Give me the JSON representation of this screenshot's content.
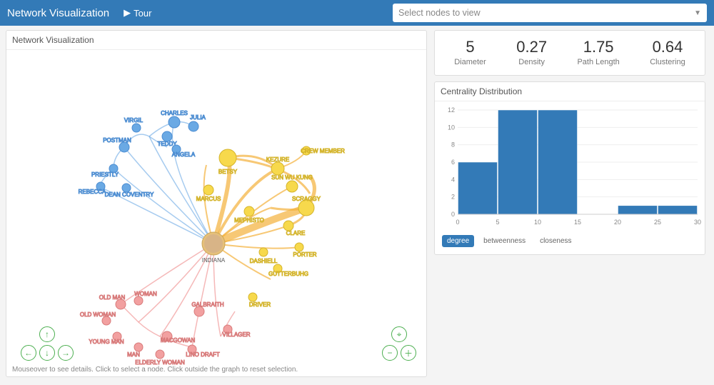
{
  "topbar": {
    "title": "Network Visualization",
    "tour": "Tour",
    "select_placeholder": "Select nodes to view"
  },
  "graph_panel": {
    "title": "Network Visualization",
    "hint": "Mouseover to see details. Click to select a node. Click outside the graph to reset selection."
  },
  "stats": [
    {
      "value": "5",
      "label": "Diameter"
    },
    {
      "value": "0.27",
      "label": "Density"
    },
    {
      "value": "1.75",
      "label": "Path Length"
    },
    {
      "value": "0.64",
      "label": "Clustering"
    }
  ],
  "centrality_panel_title": "Centrality Distribution",
  "centrality_buttons": {
    "degree": "degree",
    "betweenness": "betweenness",
    "closeness": "closeness"
  },
  "chart_data": {
    "type": "bar",
    "categories": [
      0,
      5,
      10,
      15,
      20,
      25,
      30
    ],
    "bin_edges": [
      0,
      5,
      10,
      15,
      20,
      25,
      30
    ],
    "values": [
      6,
      12,
      12,
      0,
      1,
      1
    ],
    "ylabel": "",
    "xlabel": "",
    "ylim": [
      0,
      12
    ],
    "y_ticks": [
      0,
      2,
      4,
      6,
      8,
      10,
      12
    ],
    "bar_color": "#337ab7"
  },
  "graph_nodes": {
    "center": {
      "label": "INDIANA"
    },
    "blue": [
      {
        "label": "CHARLES"
      },
      {
        "label": "JULIA"
      },
      {
        "label": "TEDDY"
      },
      {
        "label": "VIRGIL"
      },
      {
        "label": "ANGELA"
      },
      {
        "label": "POSTMAN"
      },
      {
        "label": "PRIESTLY"
      },
      {
        "label": "REBECCA"
      },
      {
        "label": "DEAN COVENTRY"
      }
    ],
    "yellow": [
      {
        "label": "BETSY"
      },
      {
        "label": "KEZURE"
      },
      {
        "label": "CREW MEMBER"
      },
      {
        "label": "MARCUS"
      },
      {
        "label": "SUN WU KUNG"
      },
      {
        "label": "MEPHISTO"
      },
      {
        "label": "SCRAGGY"
      },
      {
        "label": "CLARE"
      },
      {
        "label": "PORTER"
      },
      {
        "label": "DASHIELL"
      },
      {
        "label": "GUTTERBUHG"
      },
      {
        "label": "DRIVER"
      }
    ],
    "pink": [
      {
        "label": "OLD MAN"
      },
      {
        "label": "WOMAN"
      },
      {
        "label": "OLD WOMAN"
      },
      {
        "label": "GALBRAITH"
      },
      {
        "label": "YOUNG MAN"
      },
      {
        "label": "MACGOWAN"
      },
      {
        "label": "VILLAGER"
      },
      {
        "label": "MAN"
      },
      {
        "label": "ELDERLY WOMAN"
      },
      {
        "label": "LINO DRAFT"
      }
    ]
  }
}
